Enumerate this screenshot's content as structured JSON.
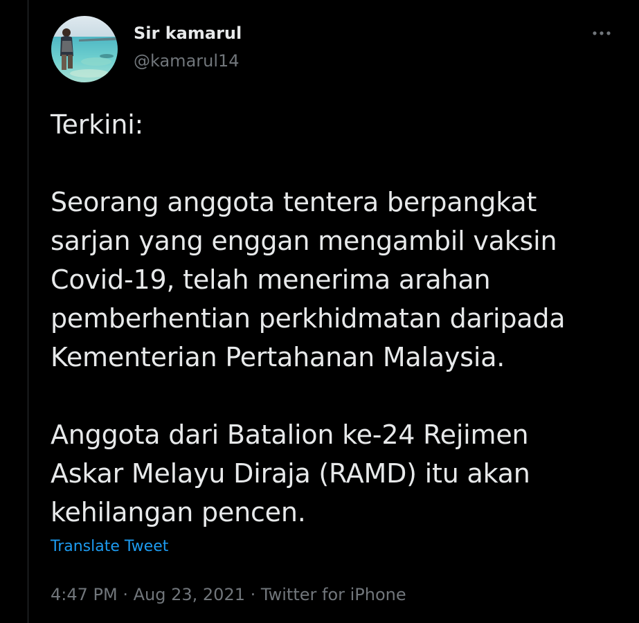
{
  "user": {
    "display_name": "Sir kamarul",
    "handle": "@kamarul14",
    "avatar_icon": "profile-photo-beach"
  },
  "more_icon": "more-horizontal-icon",
  "tweet": {
    "paragraphs": [
      "Terkini:",
      "Seorang anggota tentera berpangkat\nsarjan yang enggan mengambil vaksin\nCovid-19, telah menerima arahan\npemberhentian perkhidmatan daripada\nKementerian Pertahanan Malaysia.",
      "Anggota dari Batalion ke-24 Rejimen\nAskar Melayu Diraja (RAMD) itu akan\nkehilangan pencen."
    ],
    "translate_label": "Translate Tweet"
  },
  "meta": {
    "time": "4:47 PM",
    "date": "Aug 23, 2021",
    "source": "Twitter for iPhone",
    "separator": "·"
  },
  "colors": {
    "background": "#000000",
    "text": "#e7e9ea",
    "secondary": "#71767b",
    "link": "#1d9bf0"
  }
}
